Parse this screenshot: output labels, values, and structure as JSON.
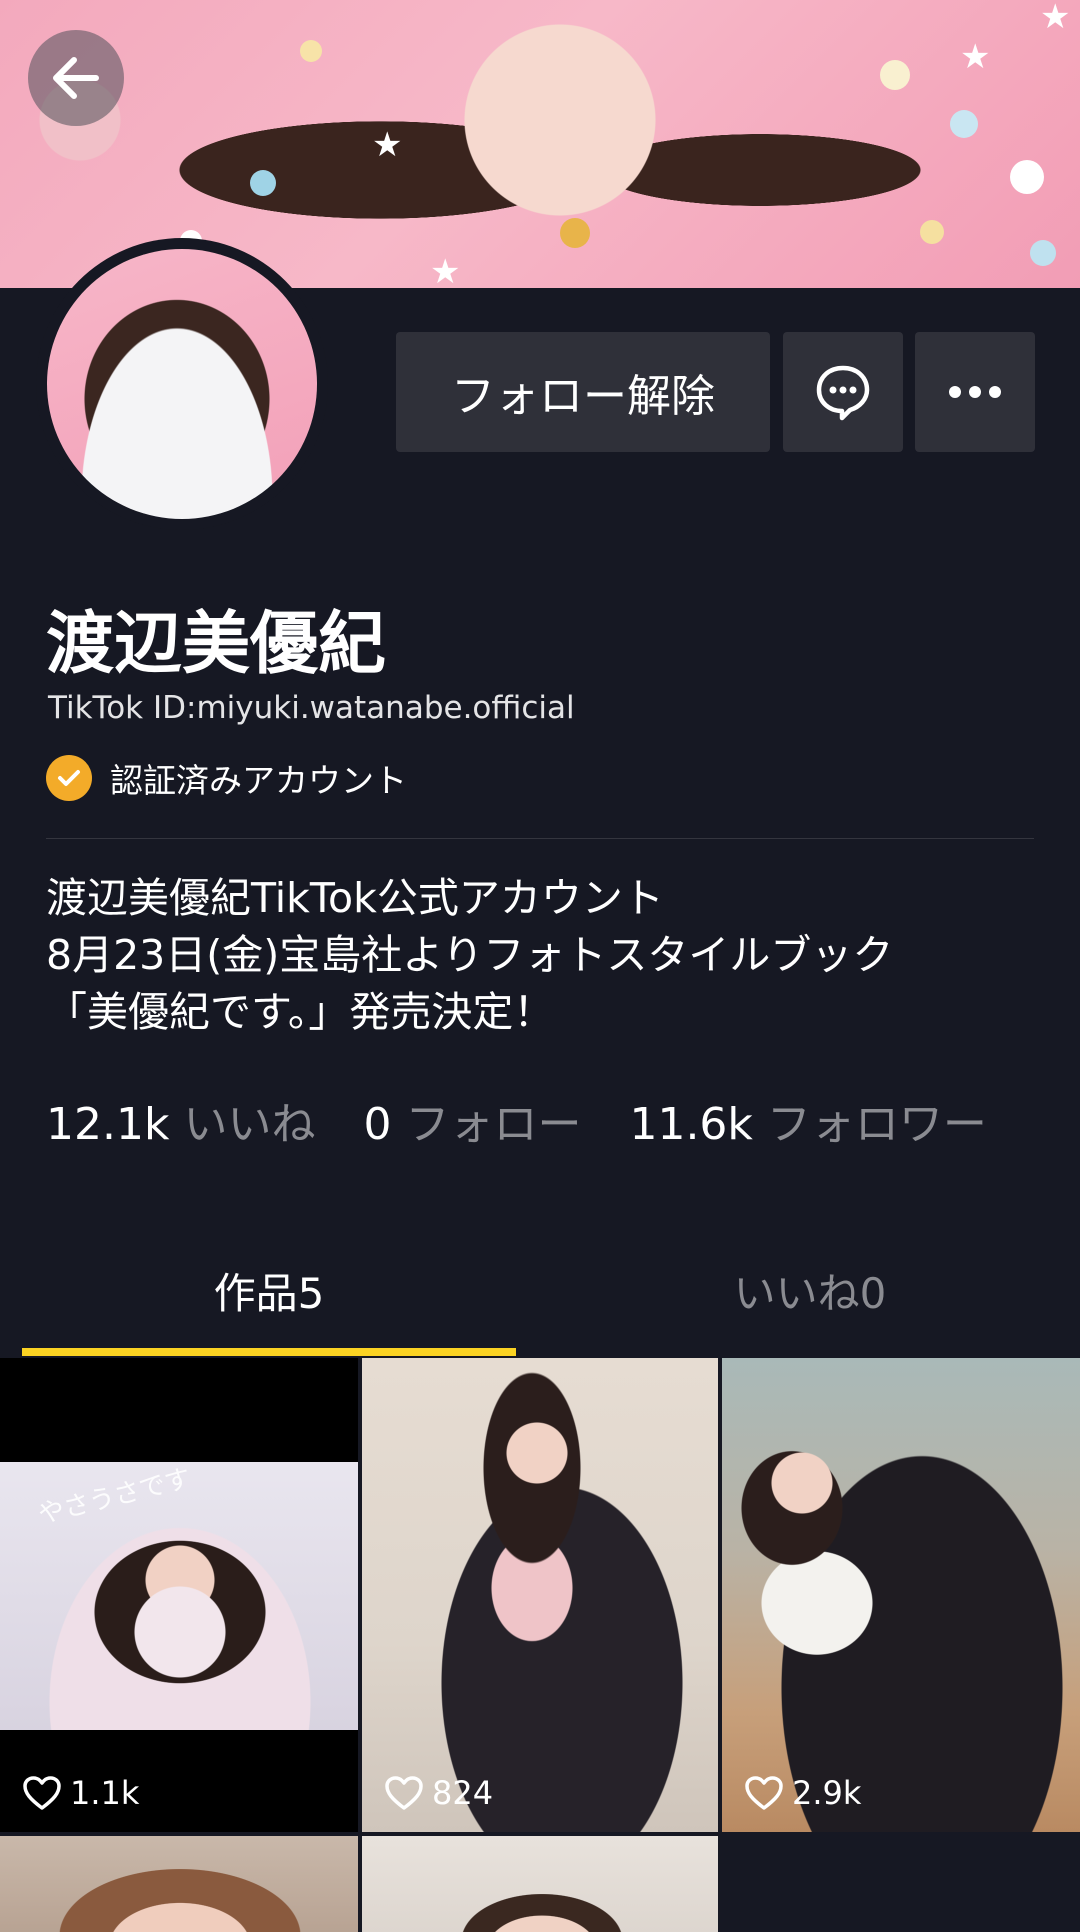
{
  "profile": {
    "name": "渡辺美優紀",
    "tiktok_id": "TikTok ID:miyuki.watanabe.official",
    "verified_label": "認証済みアカウント",
    "bio_lines": [
      "渡辺美優紀TikTok公式アカウント",
      "8月23日(金)宝島社よりフォトスタイルブック",
      "「美優紀です。」発売決定！"
    ]
  },
  "actions": {
    "unfollow_label": "フォロー解除",
    "message_icon": "chat-bubble-icon",
    "more_icon": "more-dots-icon"
  },
  "stats": [
    {
      "value": "12.1k",
      "label": "いいね"
    },
    {
      "value": "0",
      "label": "フォロー"
    },
    {
      "value": "11.6k",
      "label": "フォロワー"
    }
  ],
  "tabs": [
    {
      "label": "作品5",
      "active": true
    },
    {
      "label": "いいね0",
      "active": false
    }
  ],
  "videos": [
    {
      "likes": "1.1k",
      "caption": "やさうさです"
    },
    {
      "likes": "824"
    },
    {
      "likes": "2.9k"
    }
  ],
  "colors": {
    "background": "#161823",
    "button": "#2f3039",
    "accent_yellow": "#fbd323",
    "verified_orange": "#f3ab29"
  }
}
